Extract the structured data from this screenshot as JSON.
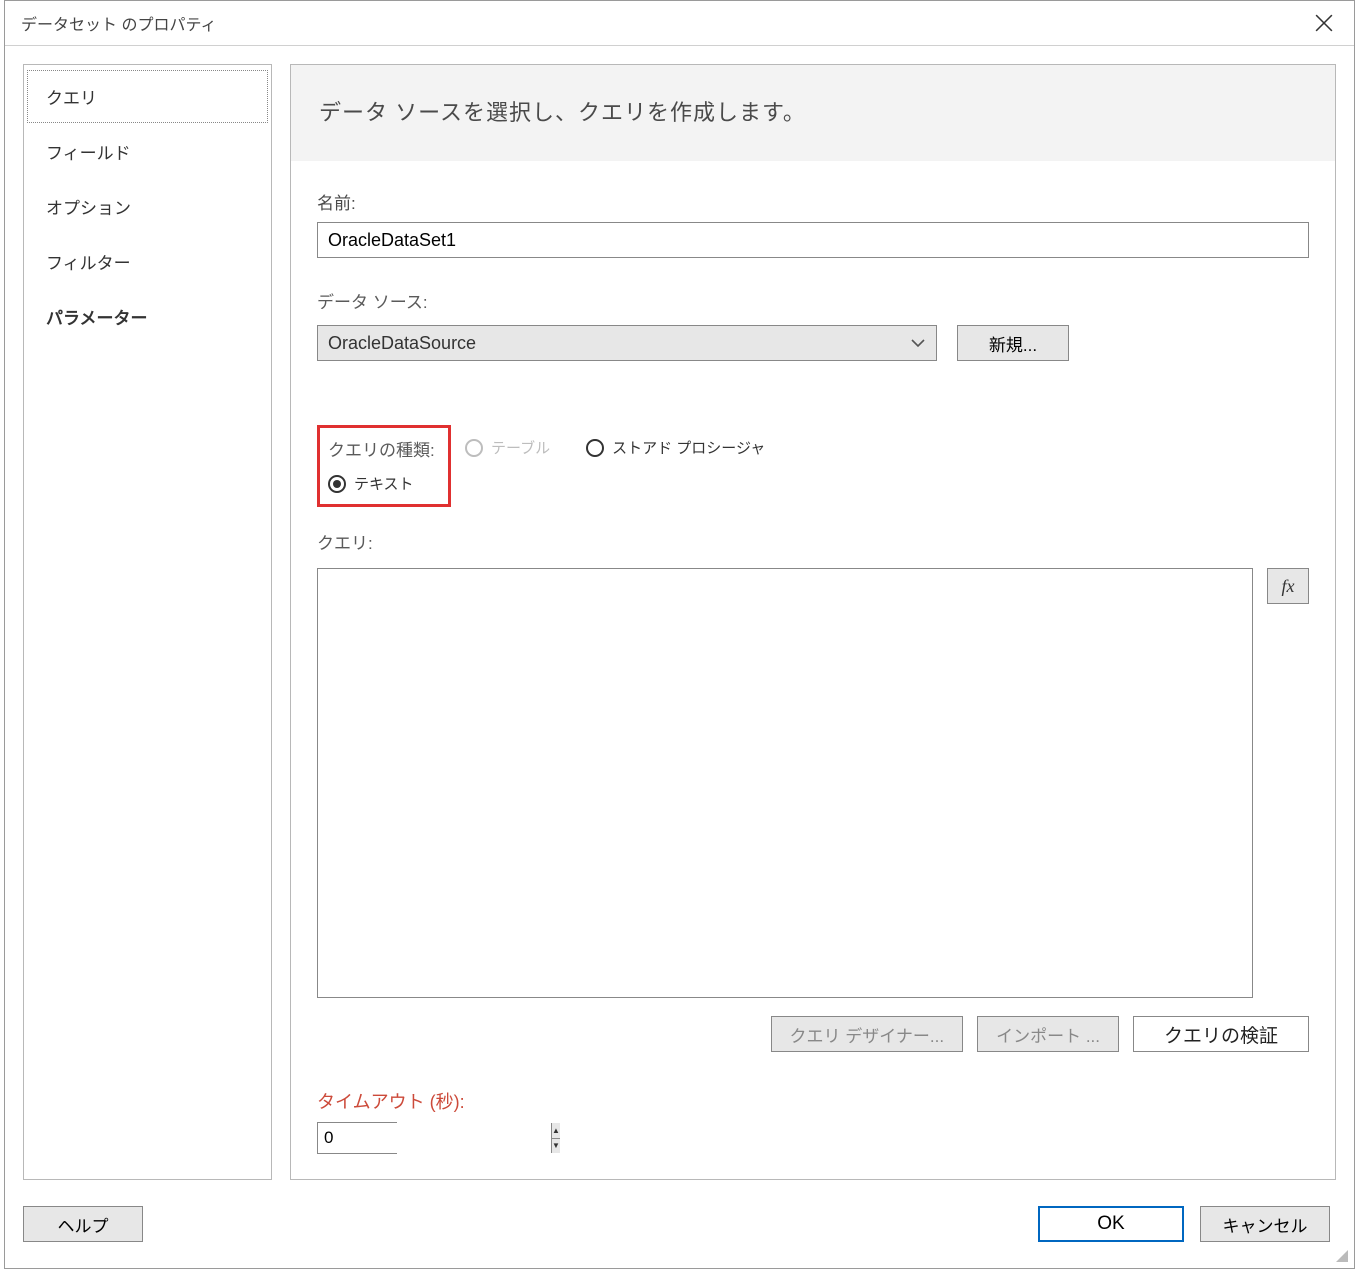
{
  "titlebar": {
    "title": "データセット のプロパティ"
  },
  "sidebar": {
    "items": [
      {
        "label": "クエリ",
        "selected": true,
        "bold": false
      },
      {
        "label": "フィールド",
        "selected": false,
        "bold": false
      },
      {
        "label": "オプション",
        "selected": false,
        "bold": false
      },
      {
        "label": "フィルター",
        "selected": false,
        "bold": false
      },
      {
        "label": "パラメーター",
        "selected": false,
        "bold": true
      }
    ]
  },
  "content": {
    "header": "データ ソースを選択し、クエリを作成します。",
    "name_label": "名前:",
    "name_value": "OracleDataSet1",
    "datasource_label": "データ ソース:",
    "datasource_value": "OracleDataSource",
    "new_button": "新規...",
    "query_type_label": "クエリの種類:",
    "query_type_options": {
      "text": "テキスト",
      "table": "テーブル",
      "stored_proc": "ストアド プロシージャ"
    },
    "query_label": "クエリ:",
    "query_value": "",
    "query_designer_btn": "クエリ デザイナー...",
    "import_btn": "インポート ...",
    "validate_btn": "クエリの検証",
    "timeout_label": "タイムアウト (秒):",
    "timeout_value": "0",
    "fx_label": "fx"
  },
  "footer": {
    "help": "ヘルプ",
    "ok": "OK",
    "cancel": "キャンセル"
  }
}
